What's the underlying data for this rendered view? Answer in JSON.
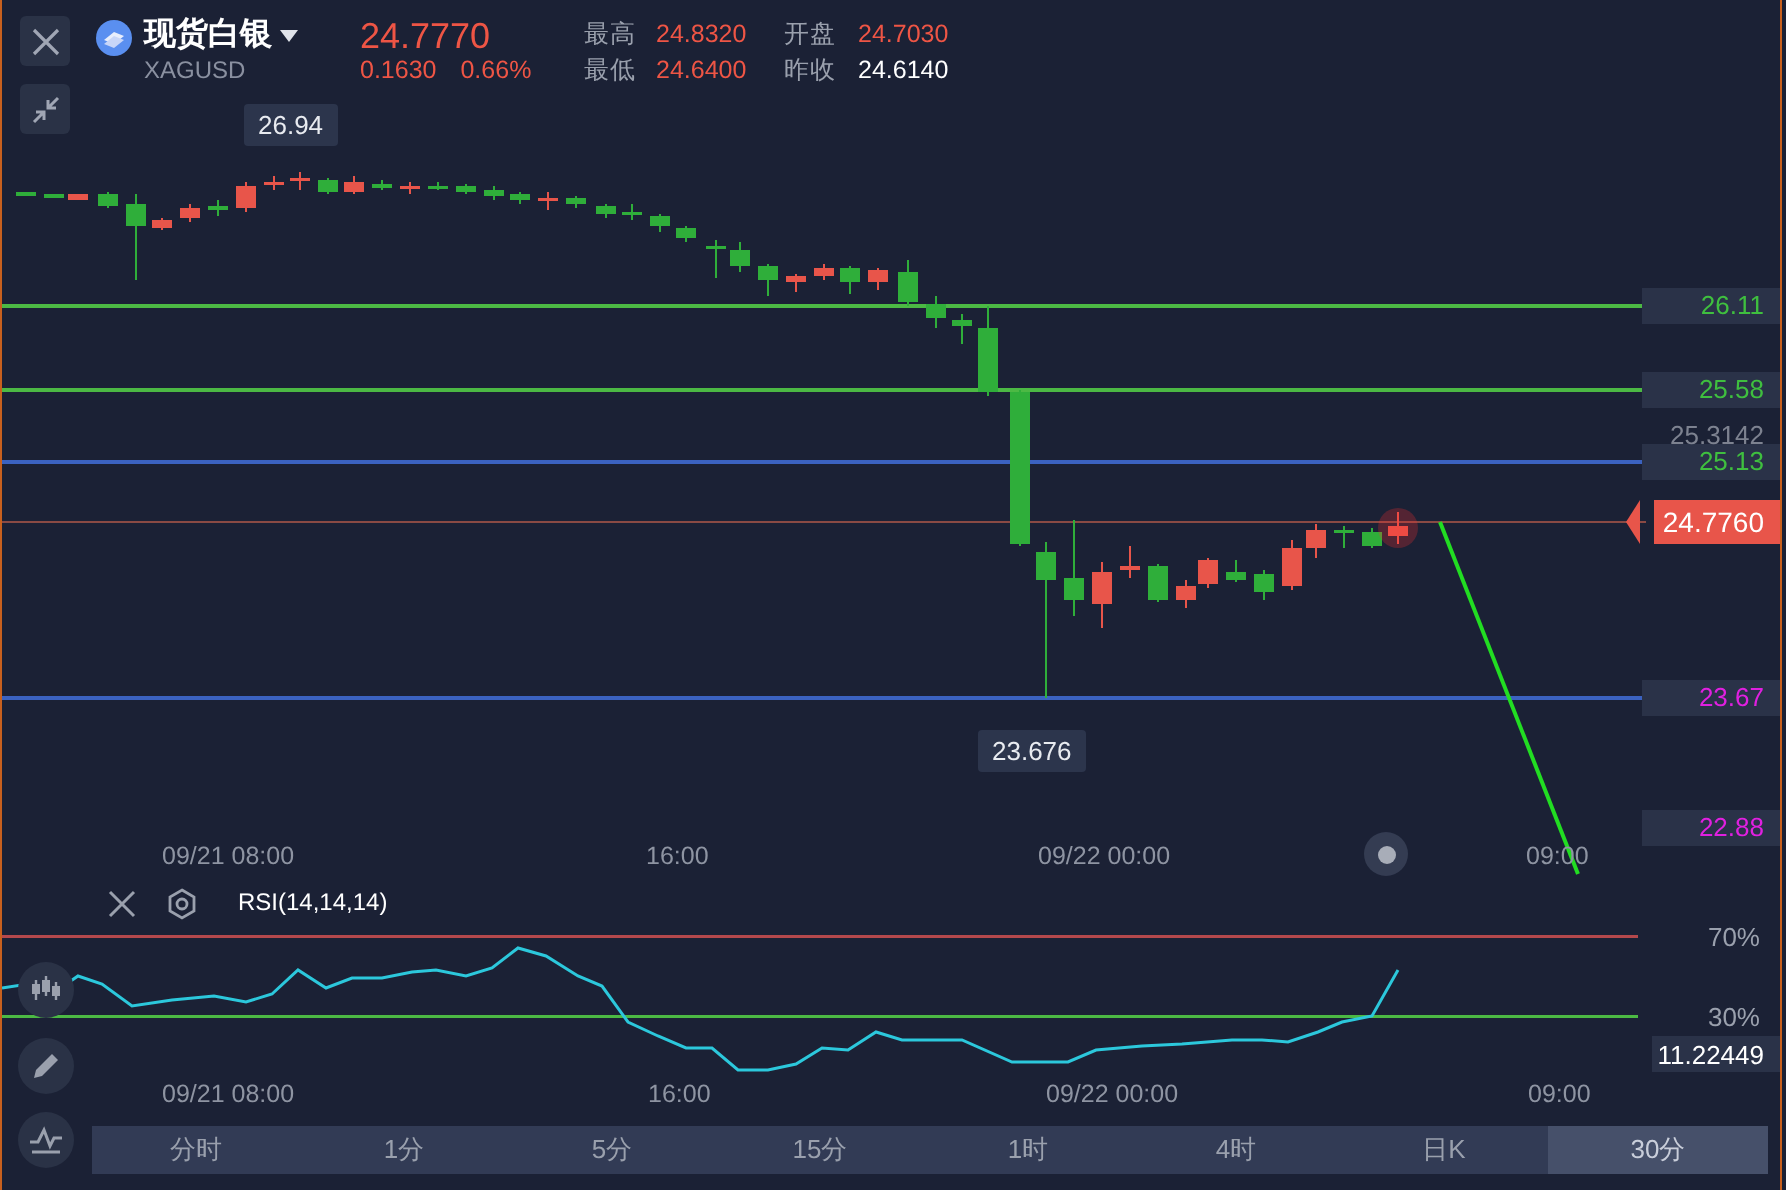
{
  "instrument": {
    "name": "现货白银",
    "symbol": "XAGUSD",
    "price": "24.7770",
    "change": "0.1630",
    "change_pct": "0.66%"
  },
  "stats": [
    {
      "label": "最高",
      "value": "24.8320",
      "kind": "rise"
    },
    {
      "label": "开盘",
      "value": "24.7030",
      "kind": "rise"
    },
    {
      "label": "最低",
      "value": "24.6400",
      "kind": "rise"
    },
    {
      "label": "昨收",
      "value": "24.6140",
      "kind": "base"
    }
  ],
  "chart": {
    "high_marker": "26.94",
    "low_marker": "23.676",
    "ref_price": "25.3142",
    "current_price": "24.7760",
    "levels": [
      {
        "label": "26.11",
        "color": "#3fbf3f",
        "kind": "green-line"
      },
      {
        "label": "25.58",
        "color": "#3fbf3f",
        "kind": "green-line"
      },
      {
        "label": "25.13",
        "color": "#3fbf3f",
        "kind": "blue-line"
      },
      {
        "label": "23.67",
        "color": "#e020e0",
        "kind": "blue-line"
      },
      {
        "label": "22.88",
        "color": "#e020e0",
        "kind": "no-line"
      }
    ],
    "time_axis": [
      "09/21 08:00",
      "16:00",
      "09/22 00:00",
      "09:00"
    ]
  },
  "rsi": {
    "title": "RSI(14,14,14)",
    "upper": "70%",
    "lower": "30%",
    "value": "11.22449",
    "time_axis": [
      "09/21 08:00",
      "16:00",
      "09/22 00:00",
      "09:00"
    ]
  },
  "timeframes": [
    {
      "label": "分时",
      "selected": false
    },
    {
      "label": "1分",
      "selected": false
    },
    {
      "label": "5分",
      "selected": false
    },
    {
      "label": "15分",
      "selected": false
    },
    {
      "label": "1时",
      "selected": false
    },
    {
      "label": "4时",
      "selected": false
    },
    {
      "label": "日K",
      "selected": false
    },
    {
      "label": "30分",
      "selected": true
    }
  ]
}
